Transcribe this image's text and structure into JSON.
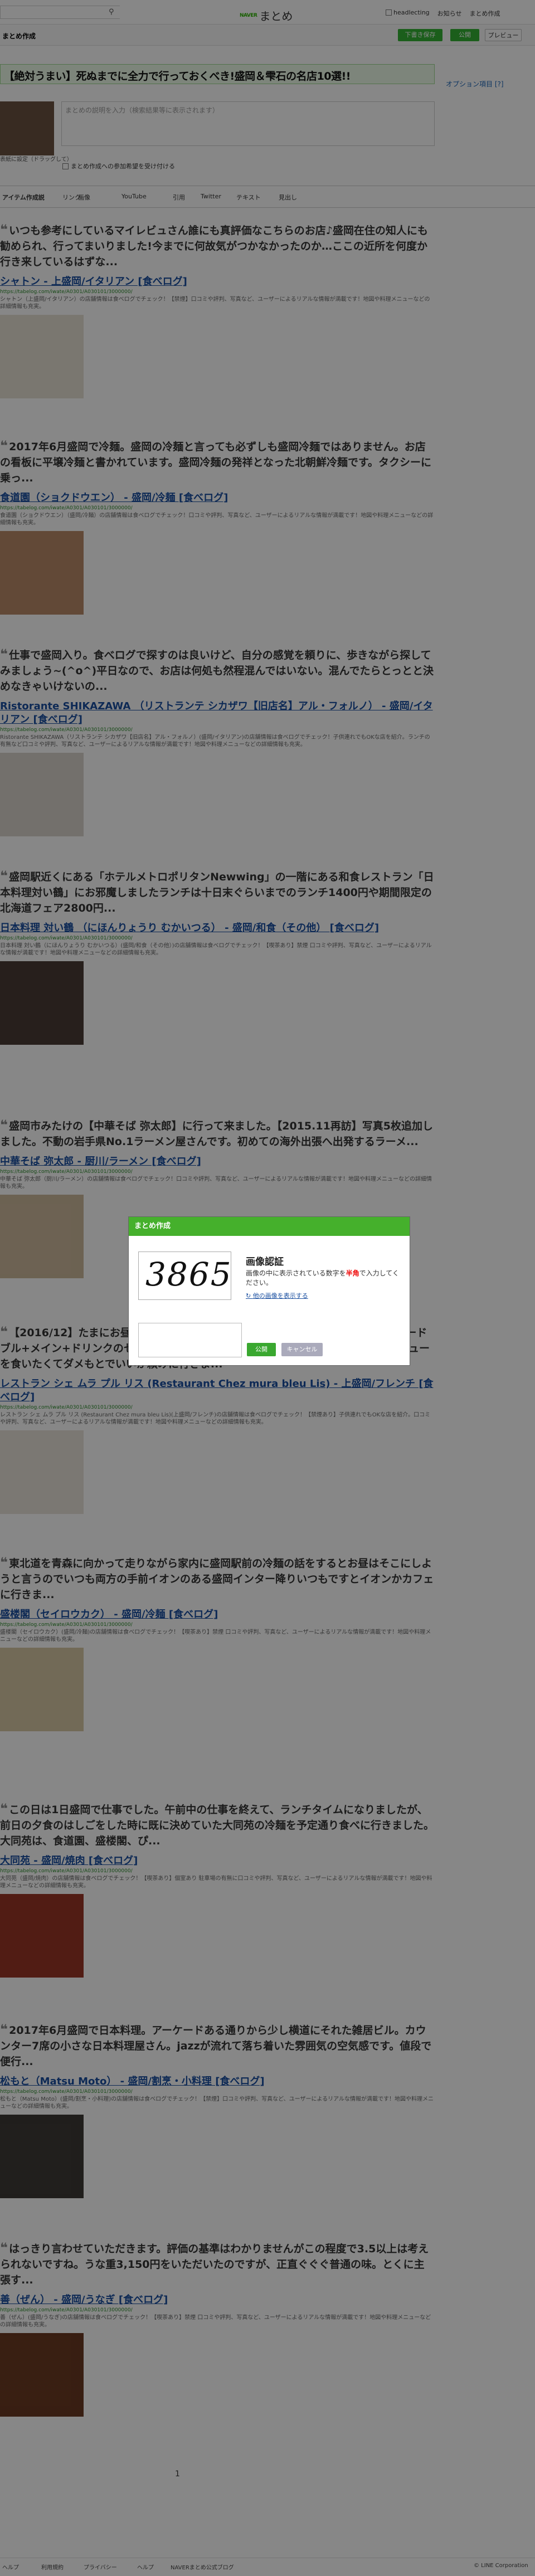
{
  "header": {
    "search_icon": "search-icon",
    "brand_naver": "NAVER",
    "brand_matome": "まとめ",
    "links": [
      "headlecting",
      "お知らせ",
      "まとめ作成"
    ]
  },
  "subheader": {
    "label": "まとめ作成",
    "btn_draft": "下書き保存",
    "btn_publish": "公開",
    "btn_preview": "プレビュー"
  },
  "matome": {
    "title": "【絶対うまい】死ぬまでに全力で行っておくべき!盛岡＆雫石の名店10選!!",
    "option_link": "オプション項目 [?]",
    "thumb_label": "表紙に設定（ドラッグして）",
    "desc_placeholder": "まとめの説明を入力（検索結果等に表示されます）",
    "include_label": "まとめ作成への参加希望を受け付ける"
  },
  "tabs": [
    "アイテム作成説",
    "リンク",
    "画像",
    "YouTube",
    "引用",
    "Twitter",
    "テキスト",
    "見出し"
  ],
  "items": [
    {
      "comment": "いつも参考にしているマイレビュさん誰にも真評価なこちらのお店♪盛岡在住の知人にも勧められ、行ってまいりました!今までに何故気がつかなかったのか…ここの近所を何度か行き来しているはずな...",
      "link": "シャトン - 上盛岡/イタリアン [食べログ]",
      "url": "https://tabelog.com/iwate/A0301/A030101/3000000/",
      "snip": "シャトン（上盛岡/イタリアン）の店舗情報は食べログでチェック！【禁煙】口コミや評判、写真など、ユーザーによるリアルな情報が満載です！地図や料理メニューなどの詳細情報も充実。",
      "img_color": "#e7e0d3"
    },
    {
      "comment": "2017年6月盛岡で冷麺。盛岡の冷麺と言っても必ずしも盛岡冷麺ではありません。お店の看板に平壌冷麺と書かれています。盛岡冷麺の発祥となった北朝鮮冷麺です。タクシーに乗っ...",
      "link": "食道園（ショクドウエン） - 盛岡/冷麺 [食べログ]",
      "url": "https://tabelog.com/iwate/A0301/A030101/3000000/",
      "snip": "食道園（ショクドウエン）（盛岡/冷麺）の店舗情報は食べログでチェック！口コミや評判、写真など、ユーザーによるリアルな情報が満載です！地図や料理メニューなどの詳細情報も充実。",
      "img_color": "#b98a68"
    },
    {
      "comment": "仕事で盛岡入り。食べログで探すのは良いけど、自分の感覚を頼りに、歩きながら探してみましょう~(^o^)平日なので、お店は何処も然程混んではいない。混んでたらとっとと決めなきゃいけないの...",
      "link": "Ristorante SHIKAZAWA （リストランテ シカザワ【旧店名】アル・フォルノ） - 盛岡/イタリアン [食べログ]",
      "url": "https://tabelog.com/iwate/A0301/A030101/3000000/",
      "snip": "Ristorante SHIKAZAWA（リストランテ シカザワ【旧店名】アル・フォルノ）(盛岡/イタリアン)の店舗情報は食べログでチェック！子供連れでもOKな店を紹介。ランチの有無など口コミや評判、写真など、ユーザーによるリアルな情報が満載です！地図や料理メニューなどの詳細情報も充実。",
      "img_color": "#d9d4cd"
    },
    {
      "comment": "盛岡駅近くにある「ホテルメトロポリタンNewwing」の一階にある和食レストラン「日本料理対い鶴」にお邪魔しましたランチは十日末ぐらいまでのランチ1400円や期間限定の北海道フェア2800円...",
      "link": "日本料理 対い鶴 （にほんりょうり むかいつる） - 盛岡/和食（その他） [食べログ]",
      "url": "https://tabelog.com/iwate/A0301/A030101/3000000/",
      "snip": "日本料理 対い鶴（にほんりょうり むかいつる）(盛岡/和食（その他）)の店舗情報は食べログでチェック！【喫茶あり】禁煙 口コミや評判、写真など、ユーザーによるリアルな情報が満載です！地図や料理メニューなどの詳細情報も充実。",
      "img_color": "#4a3b35"
    },
    {
      "comment": "盛岡市みたけの【中華そば 弥太郎】に行って来ました。【2015.11再訪】写真5枚追加しました。不動の岩手県No.1ラーメン屋さんです。初めての海外出張へ出発するラーメ...",
      "link": "中華そば 弥太郎 - 厨川/ラーメン [食べログ]",
      "url": "https://tabelog.com/iwate/A0301/A030101/3000000/",
      "snip": "中華そば 弥太郎（厨川/ラーメン）の店舗情報は食べログでチェック！口コミや評判、写真など、ユーザーによるリアルな情報が満載です！地図や料理メニューなどの詳細情報も充実。",
      "img_color": "#cdb99c"
    },
    {
      "comment": "【2016/12】たまにお昼にこのお店、ランチメニューのメインを決めずに頼むとオードブル+メイン+ドリンクのセットで、メインは小ぶりなグランドメニューのビーフシチューを食いたくてダメもとでいいか頼みに行きま...",
      "link": "レストラン シェ ムラ プル リス (Restaurant Chez mura bleu Lis) - 上盛岡/フレンチ [食べログ]",
      "url": "https://tabelog.com/iwate/A0301/A030101/3000000/",
      "snip": "レストラン シェ ムラ プル リス (Restaurant Chez mura bleu Lis)(上盛岡/フレンチ)の店舗情報は食べログでチェック！【禁煙あり】子供連れでもOKな店を紹介。口コミや評判、写真など、ユーザーによるリアルな情報が満載です！地図や料理メニューなどの詳細情報も充実。",
      "img_color": "#e8e2d9"
    },
    {
      "comment": "東北道を青森に向かって走りながら家内に盛岡駅前の冷麺の話をするとお昼はそこにしようと言うのでいつも両方の手前イオンのある盛岡インター降りいつもですとイオンかカフェに行きま...",
      "link": "盛楼閣（セイロウカク） - 盛岡/冷麺 [食べログ]",
      "url": "https://tabelog.com/iwate/A0301/A030101/3000000/",
      "snip": "盛楼閣（セイロウカク）(盛岡/冷麺)の店舗情報は食べログでチェック！【喫茶あり】禁煙 口コミや評判、写真など、ユーザーによるリアルな情報が満載です！地図や料理メニューなどの詳細情報も充実。",
      "img_color": "#d7c8a4"
    },
    {
      "comment": "この日は1日盛岡で仕事でした。午前中の仕事を終えて、ランチタイムになりましたが、前日の夕食のはしごをした時に既に決めていた大同苑の冷麺を予定通り食べに行きました。大同苑は、食道園、盛楼閣、ぴ...",
      "link": "大同苑 - 盛岡/焼肉 [食べログ]",
      "url": "https://tabelog.com/iwate/A0301/A030101/3000000/",
      "snip": "大同苑（盛岡/焼肉）の店舗情報は食べログでチェック！【喫茶あり】個室あり 駐車場の有無に口コミや評判、写真など、ユーザーによるリアルな情報が満載です！地図や料理メニューなどの詳細情報も充実。",
      "img_color": "#9a3626"
    },
    {
      "comment": "2017年6月盛岡で日本料理。アーケードある通りから少し横道にそれた雑居ビル。カウンター7席の小さな日本料理屋さん。jazzが流れて落ち着いた雰囲気の空気感です。値段で便行...",
      "link": "松もと（Matsu Moto） - 盛岡/割烹・小料理 [食べログ]",
      "url": "https://tabelog.com/iwate/A0301/A030101/3000000/",
      "snip": "松もと（Matsu Moto）(盛岡/割烹・小料理)の店舗情報は食べログでチェック！【禁煙】口コミや評判、写真など、ユーザーによるリアルな情報が満載です！地図や料理メニューなどの詳細情報も充実。",
      "img_color": "#3e3a36"
    },
    {
      "comment": "はっきり言わせていただきます。評価の基準はわかりませんがこの程度で3.5以上は考えられないですね。うな重3,150円をいただいたのですが、正直ぐぐぐ普通の味。とくに主張す...",
      "link": "善（ぜん） - 盛岡/うなぎ [食べログ]",
      "url": "https://tabelog.com/iwate/A0301/A030101/3000000/",
      "snip": "善（ぜん）(盛岡/うなぎ)の店舗情報は食べログでチェック！【喫茶あり】禁煙 口コミや評判、写真など、ユーザーによるリアルな情報が満載です！地図や料理メニューなどの詳細情報も充実。",
      "img_color": "#6b3a22"
    }
  ],
  "pager": {
    "page": "1"
  },
  "footer": {
    "links": [
      "ヘルプ",
      "利用規約",
      "プライバシー",
      "ヘルプ",
      "NAVERまとめ公式ブログ"
    ],
    "copyright": "© LINE Corporation"
  },
  "modal": {
    "header": "まとめ作成",
    "captcha_text": "3865",
    "title": "画像認証",
    "desc_before": "画像の中に表示されている数字を",
    "desc_red": "半角",
    "desc_after": "で入力してください。",
    "refresh_link": "他の画像を表示する",
    "ok": "公開",
    "cancel": "キャンセル"
  }
}
